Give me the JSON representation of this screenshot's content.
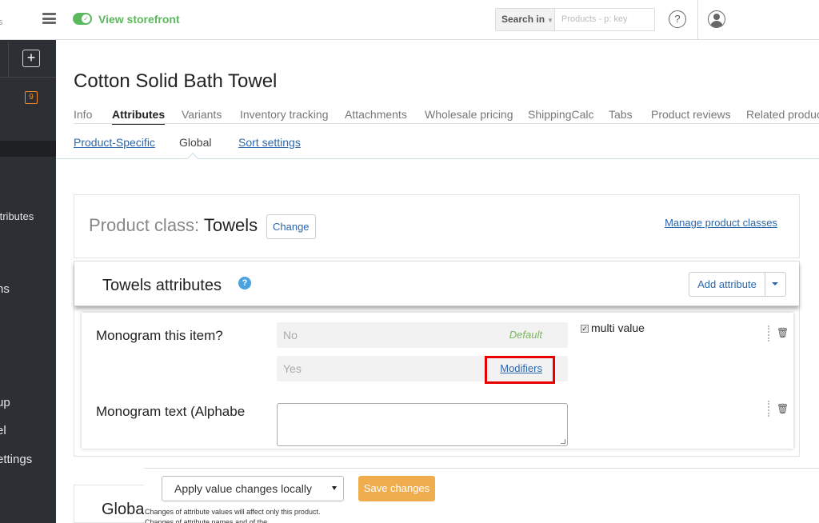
{
  "sidebar": {
    "top_fragment": "s",
    "badge_count": "9",
    "items": [
      {
        "label": "ttributes"
      },
      {
        "label": "ns"
      },
      {
        "label": "up"
      },
      {
        "label": "el"
      },
      {
        "label": "ettings"
      }
    ]
  },
  "header": {
    "storefront_label": "View storefront",
    "search_scope": "Search in",
    "search_placeholder": "Products - p: key",
    "help_glyph": "?"
  },
  "product": {
    "title": "Cotton Solid Bath Towel"
  },
  "tabs": [
    {
      "label": "Info"
    },
    {
      "label": "Attributes",
      "active": true
    },
    {
      "label": "Variants"
    },
    {
      "label": "Inventory tracking"
    },
    {
      "label": "Attachments"
    },
    {
      "label": "Wholesale pricing"
    },
    {
      "label": "ShippingCalc"
    },
    {
      "label": "Tabs"
    },
    {
      "label": "Product reviews"
    },
    {
      "label": "Related produc"
    }
  ],
  "subtabs": [
    {
      "label": "Product-Specific"
    },
    {
      "label": "Global",
      "active": true
    },
    {
      "label": "Sort settings"
    }
  ],
  "product_class": {
    "prefix": "Product class: ",
    "value": "Towels",
    "change_label": "Change",
    "manage_label": "Manage product classes"
  },
  "attributes_section": {
    "title": "Towels attributes",
    "add_label": "Add attribute",
    "attributes": [
      {
        "name": "Monogram this item?",
        "values": [
          {
            "text": "No",
            "tag": "Default"
          },
          {
            "text": "Yes",
            "link": "Modifiers"
          }
        ],
        "multi_value_label": "multi value",
        "multi_value_checked": true
      },
      {
        "name": "Monogram text (Alphabe",
        "input_type": "textarea"
      }
    ]
  },
  "bottom": {
    "global_title": "Globa",
    "apply_select": "Apply value changes locally",
    "save_label": "Save changes",
    "notice": "Changes of attribute values will affect only this product. Changes of attribute names and of the"
  },
  "colors": {
    "accent_green": "#5cb85c",
    "link_blue": "#2c67ad",
    "save_orange": "#f0ad4e",
    "highlight_red": "#e60000",
    "sidebar_bg": "#2c2f34"
  }
}
